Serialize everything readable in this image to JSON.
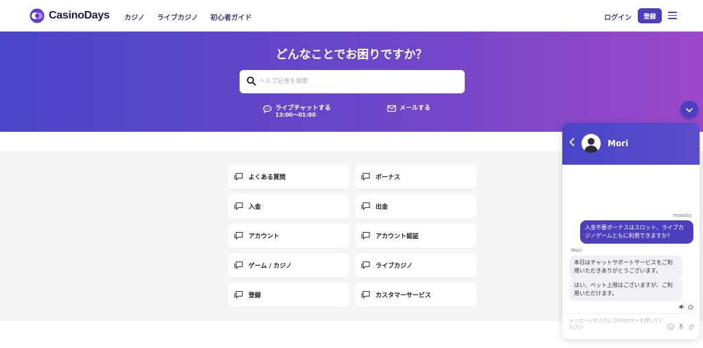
{
  "header": {
    "brand": "CasinoDays",
    "nav": [
      {
        "label": "カジノ"
      },
      {
        "label": "ライブカジノ"
      },
      {
        "label": "初心者ガイド"
      }
    ],
    "login_label": "ログイン",
    "register_label": "登録"
  },
  "hero": {
    "title": "どんなことでお困りですか？",
    "search_placeholder": "ヘルプ記事を検索",
    "livechat_label": "ライブチャットする",
    "livechat_hours": "13:00〜01:00",
    "email_label": "メールする"
  },
  "categories": [
    {
      "label": "よくある質問"
    },
    {
      "label": "ボーナス"
    },
    {
      "label": "入金"
    },
    {
      "label": "出金"
    },
    {
      "label": "アカウント"
    },
    {
      "label": "アカウント認証"
    },
    {
      "label": "ゲーム / カジノ"
    },
    {
      "label": "ライブカジノ"
    },
    {
      "label": "登録"
    },
    {
      "label": "カスタマーサービス"
    }
  ],
  "chat": {
    "agent_name": "Mori",
    "user_name": "makoto",
    "user_message": "入金不要ボーナスはスロット、ライブカジノゲームともに利用できますか？",
    "agent_label": "Mori",
    "agent_messages": [
      "本日はチャットサポートサービスをご利用いただきありがとうございます。",
      "はい、ベット上限はございますが、ご利用いただけます。"
    ],
    "input_placeholder": "メッセージを入力してEnterキーを押してください"
  },
  "colors": {
    "accent": "#4c3fbf",
    "hero_start": "#4a45c8",
    "hero_end": "#9b48c8",
    "section_bg": "#f5f5f6"
  },
  "icons": {
    "logo": "casino-days-logo-icon",
    "search": "search-icon",
    "chat": "chat-bubble-icon",
    "mail": "mail-icon",
    "category": "help-topic-icon"
  }
}
